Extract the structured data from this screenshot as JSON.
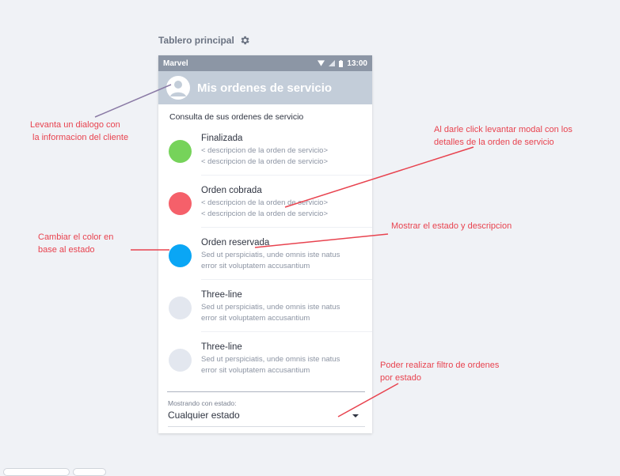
{
  "board": {
    "title": "Tablero principal",
    "settings_icon": "gear-icon"
  },
  "statusbar": {
    "carrier": "Marvel",
    "time": "13:00",
    "icons": [
      "wifi-icon",
      "signal-icon",
      "battery-icon"
    ]
  },
  "appbar": {
    "title": "Mis ordenes de servicio",
    "avatar_icon": "user-avatar-icon"
  },
  "list": {
    "subheader": "Consulta de sus ordenes de servicio",
    "items": [
      {
        "title": "Finalizada",
        "line1": "< descripcion de la orden de servicio>",
        "line2": "< descripcion de la orden de servicio>",
        "color": "#76d35a"
      },
      {
        "title": "Orden cobrada",
        "line1": "< descripcion de la orden de servicio>",
        "line2": "< descripcion de la orden de servicio>",
        "color": "#f5606a"
      },
      {
        "title": "Orden reservada",
        "line1": "Sed ut perspiciatis, unde omnis iste natus",
        "line2": "error sit voluptatem accusantium",
        "color": "#0aa6f5"
      },
      {
        "title": "Three-line",
        "line1": "Sed ut perspiciatis, unde omnis iste natus",
        "line2": "error sit voluptatem accusantium",
        "color": "#e3e7ef"
      },
      {
        "title": "Three-line",
        "line1": "Sed ut perspiciatis, unde omnis iste natus",
        "line2": "error sit voluptatem accusantium",
        "color": "#e3e7ef"
      }
    ]
  },
  "filter": {
    "label": "Mostrando con estado:",
    "value": "Cualquier estado"
  },
  "annotations": {
    "client_dialog": [
      "Levanta un dialogo con",
      "la informacion del cliente"
    ],
    "modal_details": [
      "Al darle click levantar modal con  los",
      "detalles de la orden de servicio"
    ],
    "show_state": [
      "Mostrar el estado y descripcion"
    ],
    "change_color": [
      "Cambiar el color en",
      "base al estado"
    ],
    "filter_orders": [
      "Poder realizar filtro de ordenes",
      "por estado"
    ]
  },
  "colors": {
    "annotation": "#e8434f",
    "annotation_line_dark": "#8a7aa5",
    "statusbar": "#8c96a5",
    "appbar": "#c3cdd9"
  }
}
